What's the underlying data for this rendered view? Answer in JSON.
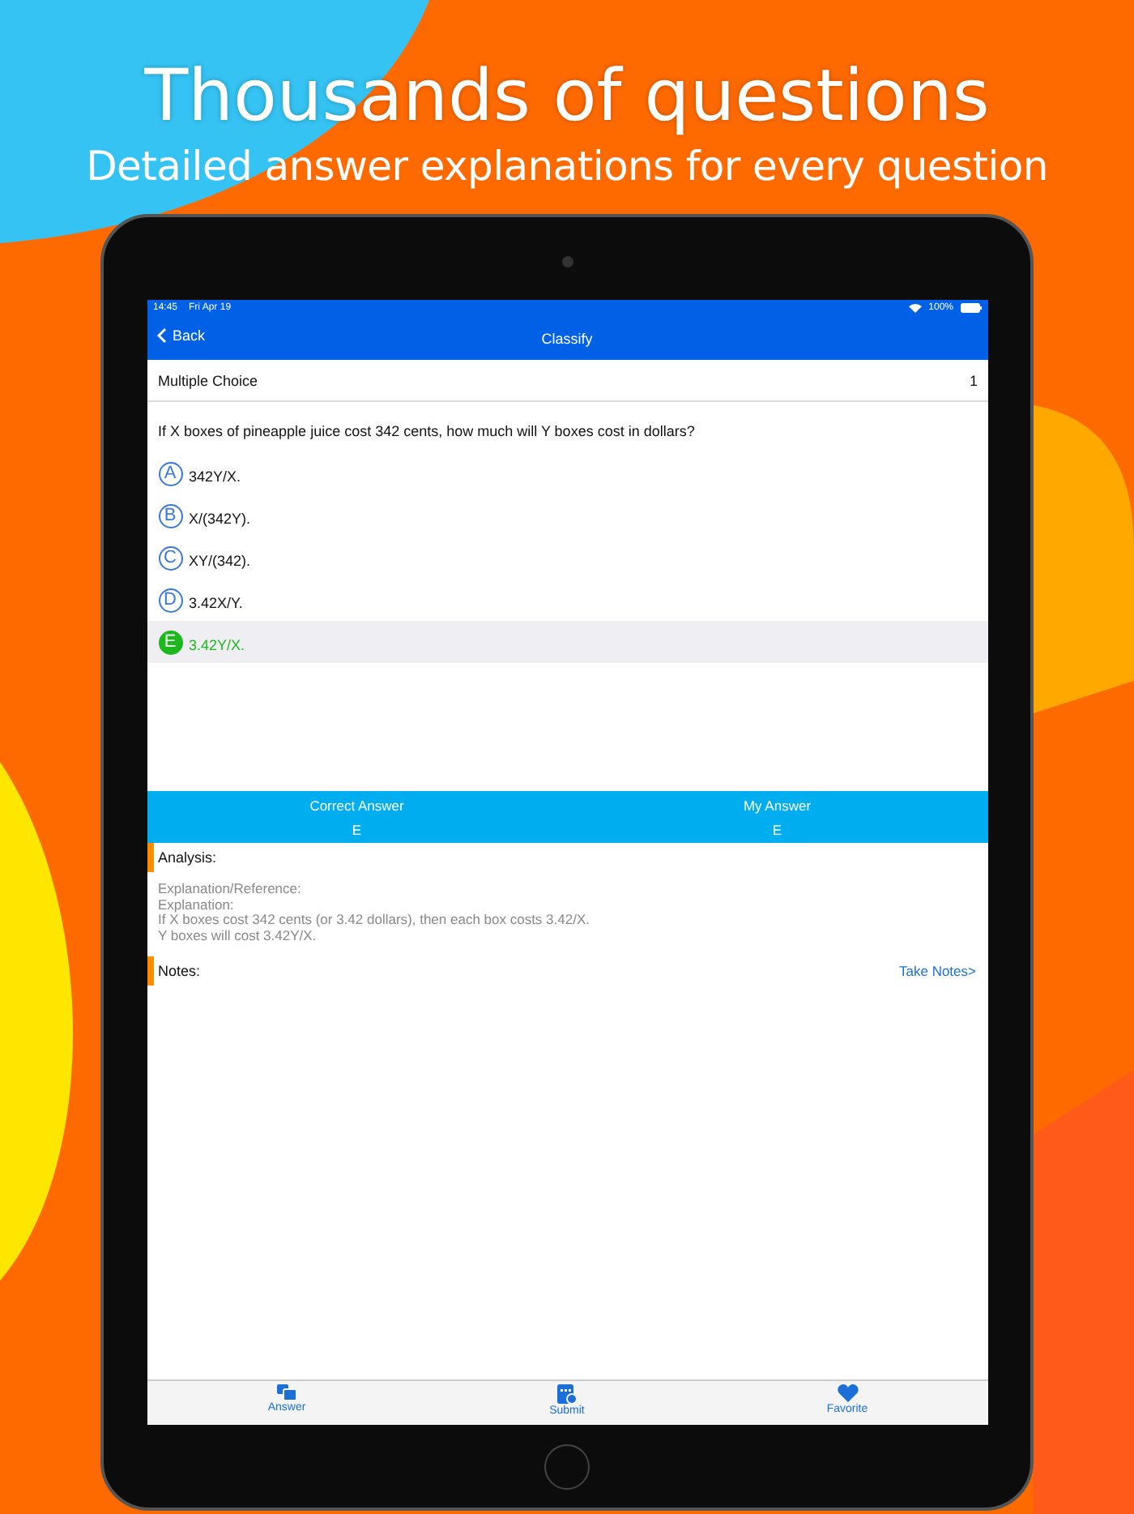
{
  "headline": "Thousands of questions",
  "subheadline": "Detailed answer explanations for every question",
  "status_bar": {
    "time": "14:45",
    "date": "Fri Apr 19",
    "battery": "100%"
  },
  "nav": {
    "back": "Back",
    "title": "Classify"
  },
  "question_type": {
    "label": "Multiple Choice",
    "number": "1"
  },
  "question": "If X boxes of pineapple juice cost 342 cents, how much will Y boxes cost in dollars?",
  "options": [
    {
      "letter": "A",
      "text": "342Y/X.",
      "selected": false
    },
    {
      "letter": "B",
      "text": "X/(342Y).",
      "selected": false
    },
    {
      "letter": "C",
      "text": "XY/(342).",
      "selected": false
    },
    {
      "letter": "D",
      "text": "3.42X/Y.",
      "selected": false
    },
    {
      "letter": "E",
      "text": "3.42Y/X.",
      "selected": true
    }
  ],
  "answers": [
    {
      "label": "Correct Answer",
      "value": "E"
    },
    {
      "label": "My Answer",
      "value": "E"
    }
  ],
  "analysis": {
    "heading": "Analysis:",
    "lines": [
      "Explanation/Reference:",
      "Explanation:",
      "If X boxes cost 342 cents (or 3.42 dollars), then each box costs 3.42/X.",
      "Y boxes will cost 3.42Y/X."
    ]
  },
  "notes": {
    "heading": "Notes:",
    "link": "Take Notes>"
  },
  "tab_bar": [
    {
      "kind": "answer",
      "label": "Answer"
    },
    {
      "kind": "submit",
      "label": "Submit"
    },
    {
      "kind": "favorite",
      "label": "Favorite"
    }
  ]
}
